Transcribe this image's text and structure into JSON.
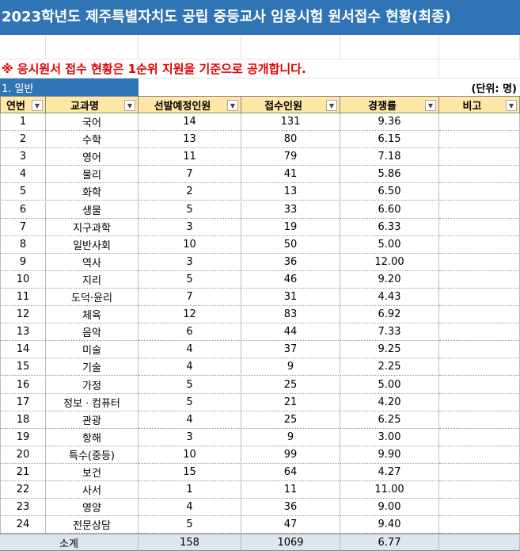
{
  "title": "2023학년도 제주특별자치도 공립 중등교사 임용시험 원서접수 현황(최종)",
  "notice": "※ 응시원서 접수 현황은 1순위 지원을 기준으로 공개합니다.",
  "section_label": "1. 일반",
  "unit_label": "(단위: 명)",
  "headers": [
    "연번",
    "교과명",
    "선발예정인원",
    "접수인원",
    "경쟁률",
    "비고"
  ],
  "rows": [
    [
      "1",
      "국어",
      "14",
      "131",
      "9.36",
      ""
    ],
    [
      "2",
      "수학",
      "13",
      "80",
      "6.15",
      ""
    ],
    [
      "3",
      "영어",
      "11",
      "79",
      "7.18",
      ""
    ],
    [
      "4",
      "물리",
      "7",
      "41",
      "5.86",
      ""
    ],
    [
      "5",
      "화학",
      "2",
      "13",
      "6.50",
      ""
    ],
    [
      "6",
      "생물",
      "5",
      "33",
      "6.60",
      ""
    ],
    [
      "7",
      "지구과학",
      "3",
      "19",
      "6.33",
      ""
    ],
    [
      "8",
      "일반사회",
      "10",
      "50",
      "5.00",
      ""
    ],
    [
      "9",
      "역사",
      "3",
      "36",
      "12.00",
      ""
    ],
    [
      "10",
      "지리",
      "5",
      "46",
      "9.20",
      ""
    ],
    [
      "11",
      "도덕·윤리",
      "7",
      "31",
      "4.43",
      ""
    ],
    [
      "12",
      "체육",
      "12",
      "83",
      "6.92",
      ""
    ],
    [
      "13",
      "음악",
      "6",
      "44",
      "7.33",
      ""
    ],
    [
      "14",
      "미술",
      "4",
      "37",
      "9.25",
      ""
    ],
    [
      "15",
      "기술",
      "4",
      "9",
      "2.25",
      ""
    ],
    [
      "16",
      "가정",
      "5",
      "25",
      "5.00",
      ""
    ],
    [
      "17",
      "정보ㆍ컴퓨터",
      "5",
      "21",
      "4.20",
      ""
    ],
    [
      "18",
      "관광",
      "4",
      "25",
      "6.25",
      ""
    ],
    [
      "19",
      "항해",
      "3",
      "9",
      "3.00",
      ""
    ],
    [
      "20",
      "특수(중등)",
      "10",
      "99",
      "9.90",
      ""
    ],
    [
      "21",
      "보건",
      "15",
      "64",
      "4.27",
      ""
    ],
    [
      "22",
      "사서",
      "1",
      "11",
      "11.00",
      ""
    ],
    [
      "23",
      "영양",
      "4",
      "36",
      "9.00",
      ""
    ],
    [
      "24",
      "전문상담",
      "5",
      "47",
      "9.40",
      ""
    ]
  ],
  "total": {
    "label": "소계",
    "planned": "158",
    "applicants": "1069",
    "ratio": "6.77",
    "note": ""
  }
}
